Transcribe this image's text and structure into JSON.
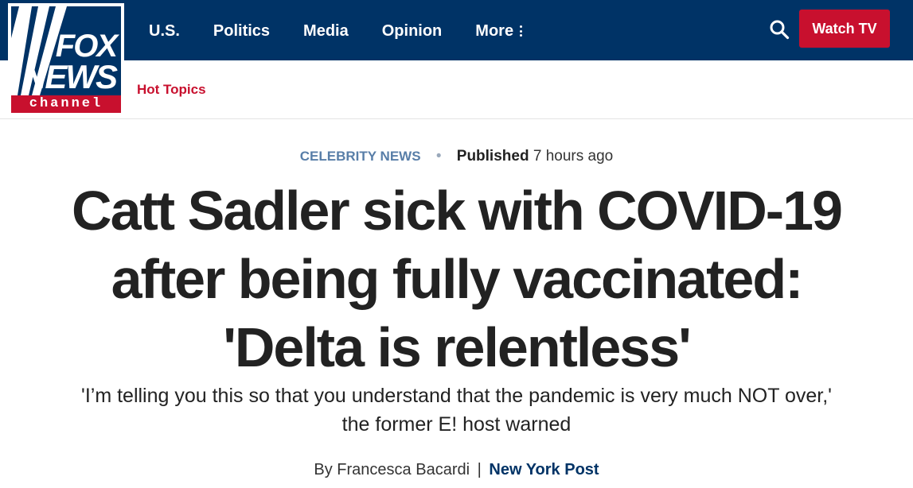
{
  "brand": {
    "logo_top": "FOX",
    "logo_middle": "NEWS",
    "logo_bottom": "channel",
    "colors": {
      "navy": "#003366",
      "red": "#c8102e",
      "eyebrow_blue": "#587ea8"
    }
  },
  "nav": {
    "items": [
      {
        "label": "U.S."
      },
      {
        "label": "Politics"
      },
      {
        "label": "Media"
      },
      {
        "label": "Opinion"
      },
      {
        "label": "More"
      }
    ],
    "more_icon": "vertical-dots-icon",
    "search_icon": "search-icon",
    "watch_tv_label": "Watch TV"
  },
  "subnav": {
    "hot_topics_label": "Hot Topics"
  },
  "article": {
    "category": "CELEBRITY NEWS",
    "separator": "•",
    "published_label": "Published",
    "published_time": "7 hours ago",
    "headline_lines": [
      "Catt Sadler sick with COVID-19",
      "after being fully vaccinated:",
      "'Delta is relentless'"
    ],
    "subheadline_lines": [
      "'I’m telling you this so that you understand that the pandemic is very much NOT over,'",
      "the former E! host warned"
    ],
    "byline_prefix": "By Francesca Bacardi",
    "byline_separator": "|",
    "byline_source": "New York Post"
  }
}
